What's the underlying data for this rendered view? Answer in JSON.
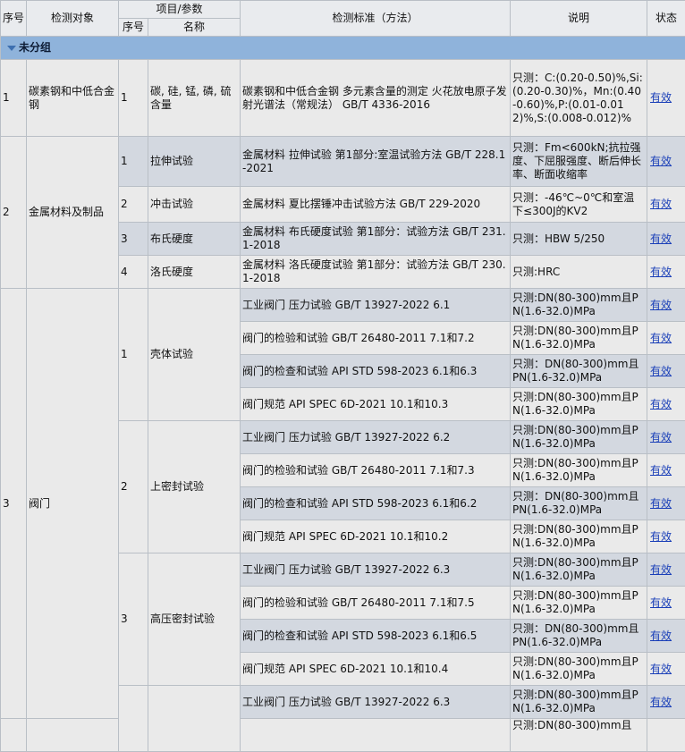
{
  "header": {
    "seq": "序号",
    "object": "检测对象",
    "item_param": "项目/参数",
    "item_seq": "序号",
    "item_name": "名称",
    "standard": "检测标准（方法）",
    "note": "说明",
    "status": "状态"
  },
  "group_label": "未分组",
  "rows": [
    {
      "no": "1",
      "object": "碳素钢和中低合金钢",
      "iseq": "1",
      "iname": "碳, 硅, 锰, 磷, 硫含量",
      "std": "碳素钢和中低合金钢 多元素含量的测定 火花放电原子发射光谱法（常规法） GB/T 4336-2016",
      "note": "只测：C:(0.20-0.50)%,Si:(0.20-0.30)%，Mn:(0.40-0.60)%,P:(0.01-0.012)%,S:(0.008-0.012)%",
      "status": "有效"
    },
    {
      "no": "2",
      "object": "金属材料及制品",
      "iseq": "1",
      "iname": "拉伸试验",
      "std": "金属材料 拉伸试验 第1部分:室温试验方法 GB/T 228.1-2021",
      "note": "只测：Fm<600kN;抗拉强度、下屈服强度、断后伸长率、断面收缩率",
      "status": "有效"
    },
    {
      "iseq": "2",
      "iname": "冲击试验",
      "std": "金属材料 夏比摆锤冲击试验方法 GB/T 229-2020",
      "note": "只测：-46℃~0℃和室温下≤300J的KV2",
      "status": "有效"
    },
    {
      "iseq": "3",
      "iname": "布氏硬度",
      "std": "金属材料 布氏硬度试验 第1部分：试验方法 GB/T 231.1-2018",
      "note": "只测：HBW 5/250",
      "status": "有效"
    },
    {
      "iseq": "4",
      "iname": "洛氏硬度",
      "std": "金属材料 洛氏硬度试验 第1部分：试验方法 GB/T 230.1-2018",
      "note": "只测:HRC",
      "status": "有效"
    },
    {
      "no": "3",
      "object": "阀门",
      "iseq": "1",
      "iname": "壳体试验",
      "std": "工业阀门 压力试验 GB/T 13927-2022 6.1",
      "note": "只测:DN(80-300)mm且PN(1.6-32.0)MPa",
      "status": "有效"
    },
    {
      "std": "阀门的检验和试验 GB/T 26480-2011 7.1和7.2",
      "note": "只测:DN(80-300)mm且PN(1.6-32.0)MPa",
      "status": "有效"
    },
    {
      "std": "阀门的检查和试验 API STD 598-2023 6.1和6.3",
      "note": "只测：DN(80-300)mm且PN(1.6-32.0)MPa",
      "status": "有效"
    },
    {
      "std": "阀门规范 API SPEC 6D-2021 10.1和10.3",
      "note": "只测:DN(80-300)mm且PN(1.6-32.0)MPa",
      "status": "有效"
    },
    {
      "iseq": "2",
      "iname": "上密封试验",
      "std": "工业阀门 压力试验 GB/T 13927-2022 6.2",
      "note": "只测:DN(80-300)mm且PN(1.6-32.0)MPa",
      "status": "有效"
    },
    {
      "std": "阀门的检验和试验 GB/T 26480-2011 7.1和7.3",
      "note": "只测:DN(80-300)mm且PN(1.6-32.0)MPa",
      "status": "有效"
    },
    {
      "std": "阀门的检查和试验 API STD 598-2023 6.1和6.2",
      "note": "只测：DN(80-300)mm且PN(1.6-32.0)MPa",
      "status": "有效"
    },
    {
      "std": "阀门规范 API SPEC 6D-2021 10.1和10.2",
      "note": "只测:DN(80-300)mm且PN(1.6-32.0)MPa",
      "status": "有效"
    },
    {
      "iseq": "3",
      "iname": "高压密封试验",
      "std": "工业阀门 压力试验 GB/T 13927-2022 6.3",
      "note": "只测:DN(80-300)mm且PN(1.6-32.0)MPa",
      "status": "有效"
    },
    {
      "std": "阀门的检验和试验 GB/T 26480-2011 7.1和7.5",
      "note": "只测:DN(80-300)mm且PN(1.6-32.0)MPa",
      "status": "有效"
    },
    {
      "std": "阀门的检查和试验 API STD 598-2023 6.1和6.5",
      "note": "只测：DN(80-300)mm且PN(1.6-32.0)MPa",
      "status": "有效"
    },
    {
      "std": "阀门规范 API SPEC 6D-2021 10.1和10.4",
      "note": "只测:DN(80-300)mm且PN(1.6-32.0)MPa",
      "status": "有效"
    },
    {
      "std": "工业阀门 压力试验 GB/T 13927-2022 6.3",
      "note": "只测:DN(80-300)mm且PN(1.6-32.0)MPa",
      "status": "有效"
    },
    {
      "std": "",
      "note": "只测:DN(80-300)mm且",
      "status": ""
    }
  ]
}
